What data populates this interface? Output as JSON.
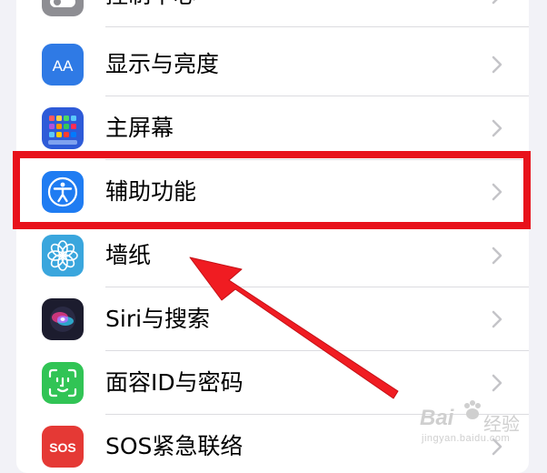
{
  "settings": {
    "rows": [
      {
        "label": "控制中心",
        "icon": "control-center-icon",
        "color": "#8e8e93"
      },
      {
        "label": "显示与亮度",
        "icon": "display-brightness-icon",
        "color": "#2f7ae5",
        "glyph": "AA"
      },
      {
        "label": "主屏幕",
        "icon": "home-screen-icon",
        "color": "#2e5bd8"
      },
      {
        "label": "辅助功能",
        "icon": "accessibility-icon",
        "color": "#1f7cf2"
      },
      {
        "label": "墙纸",
        "icon": "wallpaper-icon",
        "color": "#3aa6dd"
      },
      {
        "label": "Siri与搜索",
        "icon": "siri-icon",
        "color": "#1c1c2e"
      },
      {
        "label": "面容ID与密码",
        "icon": "face-id-icon",
        "color": "#31c455"
      },
      {
        "label": "SOS紧急联络",
        "icon": "sos-icon",
        "color": "#e53935",
        "glyph": "SOS"
      }
    ]
  },
  "annotation": {
    "highlight_color": "#e8121b",
    "highlighted_item": "辅助功能"
  },
  "watermark": {
    "brand": "Bai",
    "text": "经验",
    "url": "jingyan.baidu.com"
  }
}
